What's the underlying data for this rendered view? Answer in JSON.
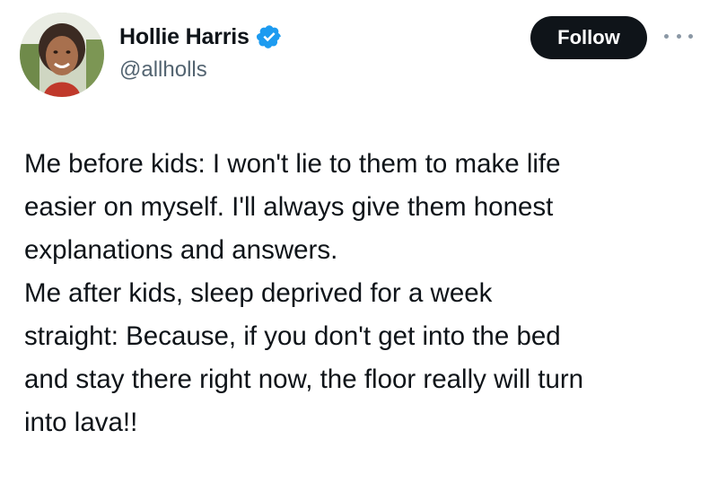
{
  "author": {
    "display_name": "Hollie Harris",
    "handle": "@allholls",
    "verified": true,
    "verified_icon": "verified-badge-icon",
    "avatar_icon": "profile-photo"
  },
  "actions": {
    "follow_label": "Follow",
    "more_icon": "ellipsis-icon"
  },
  "tweet": {
    "lines": [
      "Me before kids: I won't lie to them to make life",
      "easier on myself. I'll always give them honest",
      "explanations and answers.",
      "Me after kids, sleep deprived for a week",
      "straight: Because, if you don't get into the bed",
      "and stay there right now, the floor really will turn",
      "into lava!!"
    ]
  },
  "colors": {
    "text": "#0f1419",
    "secondary_text": "#536471",
    "follow_bg": "#0f1419",
    "verified_blue": "#1d9bf0"
  }
}
